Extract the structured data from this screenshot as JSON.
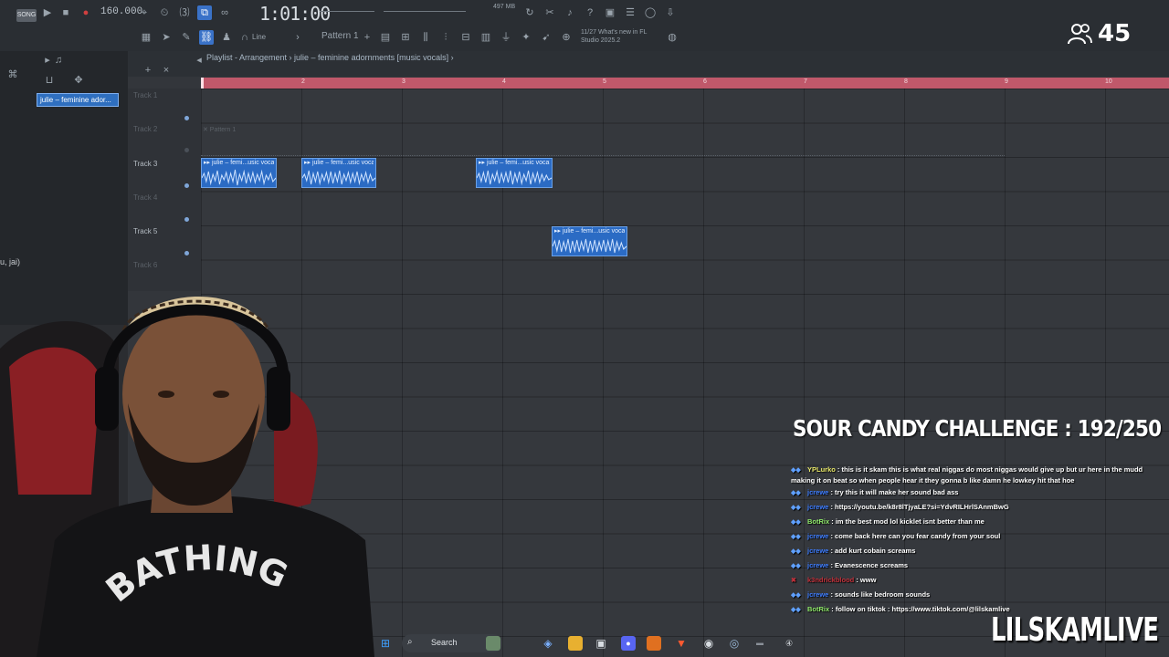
{
  "toolbar": {
    "song_mode": "SONG",
    "tempo": "160.000",
    "clock": "1:01:00",
    "memory": "497 MB",
    "cpu": "2",
    "pattern": "Pattern 1",
    "snap_label": "Line",
    "news": "11/27 What's new in FL Studio 2025.2"
  },
  "viewers": {
    "count": "45"
  },
  "browser": {
    "tab_label": "julie – feminine ador...",
    "fragment": "u, jai)"
  },
  "playlist": {
    "title": "Playlist - Arrangement › julie – feminine adornments [music vocals] ›",
    "ruler": [
      "2",
      "3",
      "4",
      "5",
      "6",
      "7",
      "8",
      "9",
      "10"
    ],
    "tracks": [
      {
        "label": "Track 1",
        "dim": true
      },
      {
        "label": "Track 2",
        "dim": true
      },
      {
        "label": "Track 3",
        "dim": false
      },
      {
        "label": "Track 4",
        "dim": true
      },
      {
        "label": "Track 5",
        "dim": false
      },
      {
        "label": "Track 6",
        "dim": true
      }
    ],
    "pattern_ghost": "✕ Pattern 1",
    "clips": [
      {
        "label": "▸▸ julie – femi...usic vocals]",
        "track": 3
      },
      {
        "label": "▸▸ julie – femi...usic vocals]",
        "track": 3
      },
      {
        "label": "▸▸ julie – femi...usic vocals]",
        "track": 3
      },
      {
        "label": "▸▸ julie – femi...usic vocals]",
        "track": 5
      }
    ]
  },
  "overlay": {
    "challenge": "SOUR CANDY CHALLENGE : 192/250",
    "streamer": "LILSKAMLIVE"
  },
  "chat": [
    {
      "user": "YPLurko",
      "color": "#e8e86a",
      "text": " : this is it skam this is what real niggas do most niggas would give up but ur here in the mudd making it on beat so when people hear it they gonna b like damn he lowkey hit that hoe"
    },
    {
      "user": "jcrewe",
      "color": "#3c7cff",
      "text": " : try this it will make her sound bad ass"
    },
    {
      "user": "jcrewe",
      "color": "#3c7cff",
      "text": " : https://youtu.be/k8r8lTjyaLE?si=YdvRILHrlSAnmBwG"
    },
    {
      "user": "BotRix",
      "color": "#8fe86a",
      "text": " : im the best mod lol kicklet isnt better than me"
    },
    {
      "user": "jcrewe",
      "color": "#3c7cff",
      "text": " : come back here can you fear candy from your soul"
    },
    {
      "user": "jcrewe",
      "color": "#3c7cff",
      "text": " : add kurt cobain screams"
    },
    {
      "user": "jcrewe",
      "color": "#3c7cff",
      "text": " : Evanescence screams"
    },
    {
      "user": "k3ndrickblood",
      "color": "#c0303a",
      "text": " : www"
    },
    {
      "user": "jcrewe",
      "color": "#3c7cff",
      "text": " : sounds like bedroom sounds"
    },
    {
      "user": "BotRix",
      "color": "#8fe86a",
      "text": " : follow on tiktok : https://www.tiktok.com/@lilskamlive"
    }
  ],
  "taskbar": {
    "search_label": "Search"
  },
  "colors": {
    "clip": "#2b6bc4",
    "ruler": "#c0586a",
    "accent": "#3a72c8"
  }
}
